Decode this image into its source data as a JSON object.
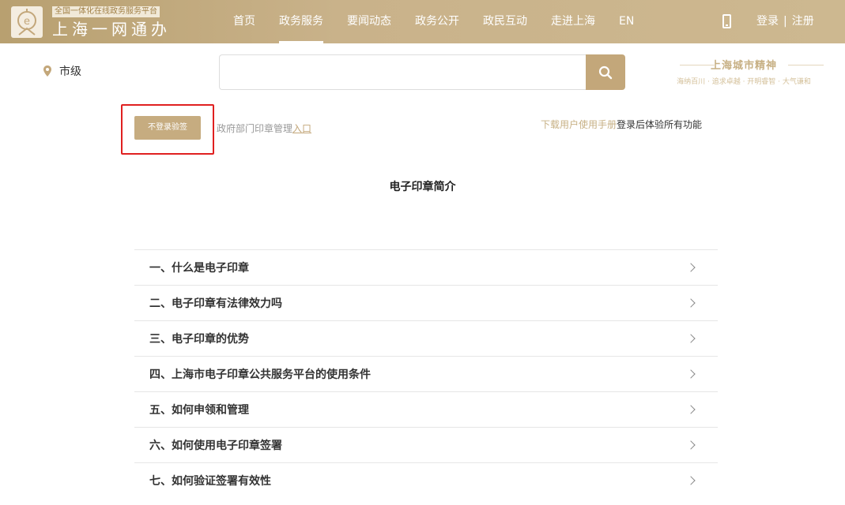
{
  "header": {
    "logo_sub": "全国一体化在线政务服务平台",
    "logo_main": "上海一网通办",
    "nav": [
      {
        "label": "首页",
        "active": false
      },
      {
        "label": "政务服务",
        "active": true
      },
      {
        "label": "要闻动态",
        "active": false
      },
      {
        "label": "政务公开",
        "active": false
      },
      {
        "label": "政民互动",
        "active": false
      },
      {
        "label": "走进上海",
        "active": false
      },
      {
        "label": "EN",
        "active": false
      }
    ],
    "login": "登录",
    "separator": "|",
    "register": "注册"
  },
  "region": {
    "label": "市级"
  },
  "search": {
    "value": "",
    "placeholder": ""
  },
  "spirit": {
    "title": "上海城市精神",
    "subtitle": "海纳百川 · 追求卓越 · 开明睿智 · 大气谦和"
  },
  "actions": {
    "verify_button": "不登录验签",
    "mgmt_text": "政府部门印章管理",
    "mgmt_link": "入口",
    "manual_link": "下载用户使用手册",
    "login_tip": "登录后体验所有功能"
  },
  "intro": {
    "title": "电子印章简介"
  },
  "faq": [
    {
      "label": "一、什么是电子印章"
    },
    {
      "label": "二、电子印章有法律效力吗"
    },
    {
      "label": "三、电子印章的优势"
    },
    {
      "label": "四、上海市电子印章公共服务平台的使用条件"
    },
    {
      "label": "五、如何申领和管理"
    },
    {
      "label": "六、如何使用电子印章签署"
    },
    {
      "label": "七、如何验证签署有效性"
    }
  ],
  "colors": {
    "brand": "#c3a77a",
    "highlight": "#e02020"
  }
}
